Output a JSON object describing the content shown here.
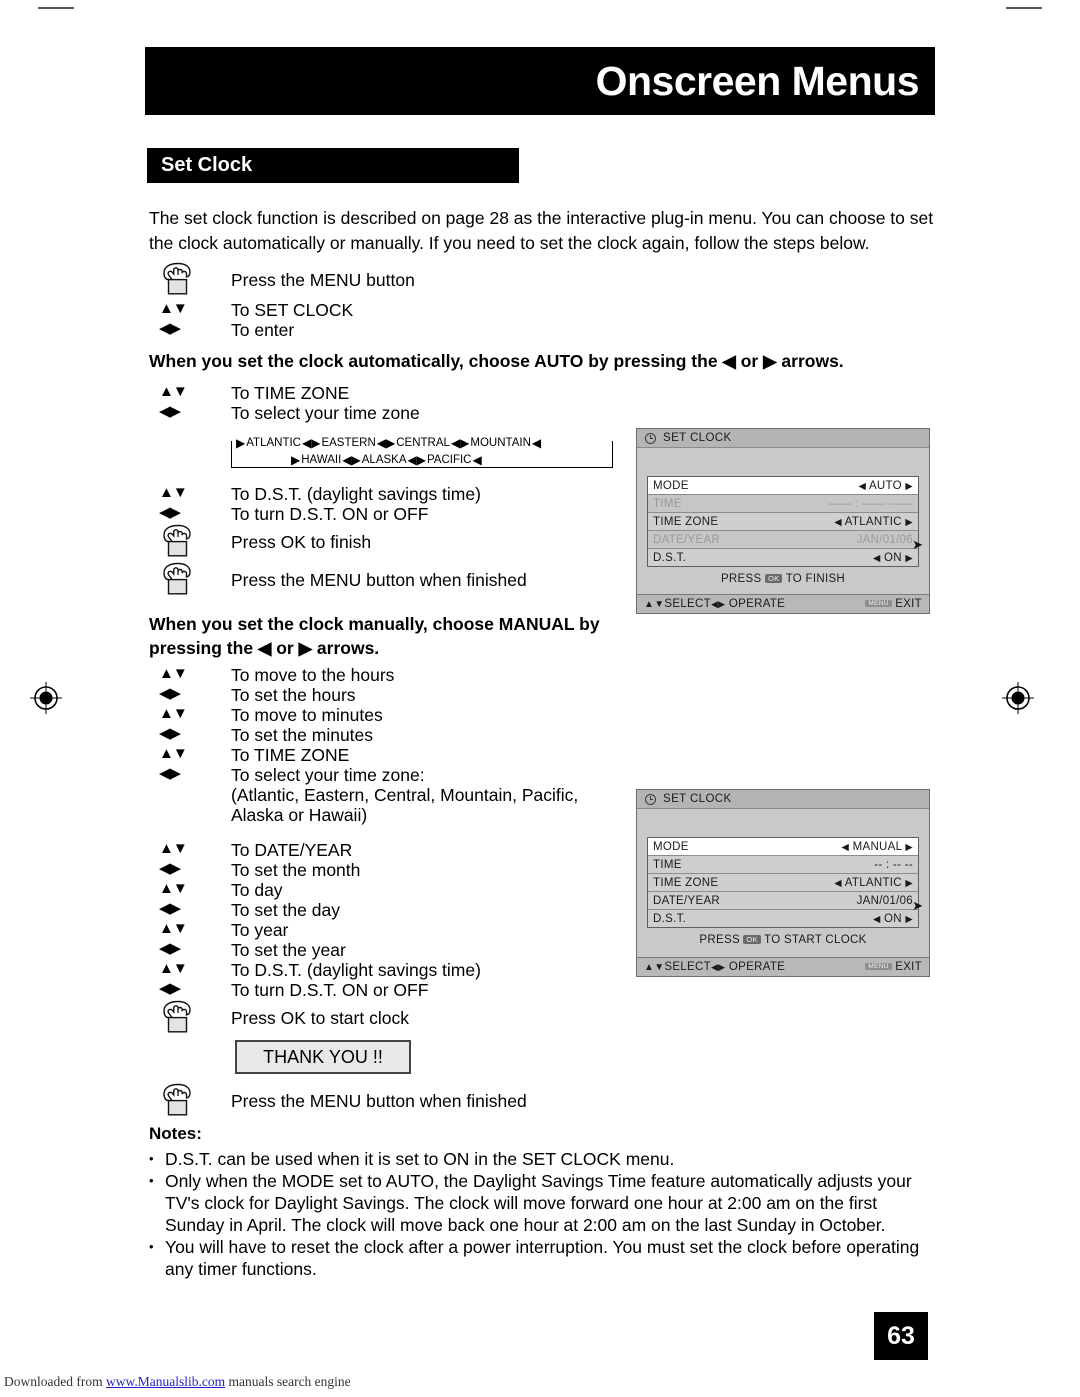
{
  "header": {
    "chapter_title": "Onscreen Menus",
    "section_title": "Set Clock"
  },
  "intro": "The set clock function is described on page 28 as the interactive plug-in menu. You can choose to set the clock automatically or manually. If you need to set the clock again, follow the steps below.",
  "leads": {
    "auto": "When you set the clock automatically, choose AUTO by pressing the ◀ or ▶ arrows.",
    "manual": "When you set the clock manually, choose MANUAL by pressing the ◀ or ▶ arrows."
  },
  "steps_group1": [
    {
      "icon": "hand-press-icon",
      "text": "Press the MENU button"
    },
    {
      "icon": "up-down-arrows-icon",
      "text": "To SET CLOCK"
    },
    {
      "icon": "left-right-arrows-icon",
      "text": "To enter"
    }
  ],
  "steps_group2": [
    {
      "icon": "up-down-arrows-icon",
      "text": "To TIME ZONE"
    },
    {
      "icon": "left-right-arrows-icon",
      "text": "To select your time zone"
    }
  ],
  "steps_group3": [
    {
      "icon": "up-down-arrows-icon",
      "text": "To D.S.T. (daylight savings time)"
    },
    {
      "icon": "left-right-arrows-icon",
      "text": "To turn D.S.T. ON or OFF"
    },
    {
      "icon": "hand-press-icon",
      "text": "Press OK to finish"
    },
    {
      "icon": "hand-press-icon",
      "text": "Press the MENU button when finished"
    }
  ],
  "steps_group4": [
    {
      "icon": "up-down-arrows-icon",
      "text": "To move to the hours"
    },
    {
      "icon": "left-right-arrows-icon",
      "text": "To set the hours"
    },
    {
      "icon": "up-down-arrows-icon",
      "text": "To move to minutes"
    },
    {
      "icon": "left-right-arrows-icon",
      "text": "To set the minutes"
    },
    {
      "icon": "up-down-arrows-icon",
      "text": "To TIME ZONE"
    },
    {
      "icon": "left-right-arrows-icon",
      "text": "To select your time zone:"
    },
    {
      "icon": "none",
      "text": "(Atlantic, Eastern, Central, Mountain, Pacific,\nAlaska or Hawaii)"
    }
  ],
  "steps_group5": [
    {
      "icon": "up-down-arrows-icon",
      "text": "To DATE/YEAR"
    },
    {
      "icon": "left-right-arrows-icon",
      "text": "To set the month"
    },
    {
      "icon": "up-down-arrows-icon",
      "text": "To day"
    },
    {
      "icon": "left-right-arrows-icon",
      "text": "To set the day"
    },
    {
      "icon": "up-down-arrows-icon",
      "text": "To year"
    },
    {
      "icon": "left-right-arrows-icon",
      "text": "To set the year"
    },
    {
      "icon": "up-down-arrows-icon",
      "text": "To D.S.T. (daylight savings time)"
    },
    {
      "icon": "left-right-arrows-icon",
      "text": "To turn D.S.T. ON or OFF"
    },
    {
      "icon": "hand-press-icon",
      "text": "Press OK to start clock"
    }
  ],
  "steps_group6": [
    {
      "icon": "hand-press-icon",
      "text": "Press the MENU button when finished"
    }
  ],
  "thank_you_label": "THANK YOU !!",
  "timezone_diagram": {
    "row1": [
      "ATLANTIC",
      "EASTERN",
      "CENTRAL",
      "MOUNTAIN"
    ],
    "row2": [
      "HAWAII",
      "ALASKA",
      "PACIFIC"
    ]
  },
  "osd_auto": {
    "title": "SET CLOCK",
    "clock_icon": "clock-icon",
    "rows": [
      {
        "label": "MODE",
        "value": "AUTO",
        "state": "highlight",
        "carets": true
      },
      {
        "label": "TIME",
        "value": "—— : —— ——",
        "state": "dim",
        "carets": false
      },
      {
        "label": "TIME ZONE",
        "value": "ATLANTIC",
        "state": "normal",
        "carets": true
      },
      {
        "label": "DATE/YEAR",
        "value": "JAN/01/06",
        "state": "dim",
        "carets": false
      },
      {
        "label": "D.S.T.",
        "value": "ON",
        "state": "normal",
        "carets": true
      }
    ],
    "press_prefix": "PRESS",
    "ok_chip": "OK",
    "press_suffix": "TO FINISH",
    "footer_left": "SELECT",
    "footer_mid": "OPERATE",
    "menu_chip": "MENU",
    "footer_right": "EXIT"
  },
  "osd_manual": {
    "title": "SET CLOCK",
    "clock_icon": "clock-icon",
    "rows": [
      {
        "label": "MODE",
        "value": "MANUAL",
        "state": "highlight",
        "carets": true
      },
      {
        "label": "TIME",
        "value": "-- : -- --",
        "state": "normal",
        "carets": false
      },
      {
        "label": "TIME ZONE",
        "value": "ATLANTIC",
        "state": "normal",
        "carets": true
      },
      {
        "label": "DATE/YEAR",
        "value": "JAN/01/06",
        "state": "normal",
        "carets": false
      },
      {
        "label": "D.S.T.",
        "value": "ON",
        "state": "normal",
        "carets": true
      }
    ],
    "press_prefix": "PRESS",
    "ok_chip": "OK",
    "press_suffix": "TO START CLOCK",
    "footer_left": "SELECT",
    "footer_mid": "OPERATE",
    "menu_chip": "MENU",
    "footer_right": "EXIT"
  },
  "notes": {
    "title": "Notes:",
    "items": [
      "D.S.T. can be used when it is set to ON in the SET CLOCK menu.",
      "Only when the MODE set to AUTO, the Daylight Savings Time feature automatically adjusts your TV's clock for Daylight Savings. The clock will move forward one hour at 2:00 am on the first Sunday in April. The clock will move back one hour at 2:00 am on the last Sunday in October.",
      "You will have to reset the clock after a power interruption. You must set the clock before operating any timer functions."
    ]
  },
  "page_number": "63",
  "download_footer": {
    "prefix": "Downloaded from ",
    "link": "www.Manualslib.com",
    "suffix": " manuals search engine"
  },
  "colors": {
    "band_black": "#000000",
    "osd_background": "#c9c9c9",
    "osd_titlebar": "#b4b4b4",
    "osd_row": "#cfcfcf",
    "osd_highlight": "#ffffff",
    "link_blue": "#2222cc"
  }
}
